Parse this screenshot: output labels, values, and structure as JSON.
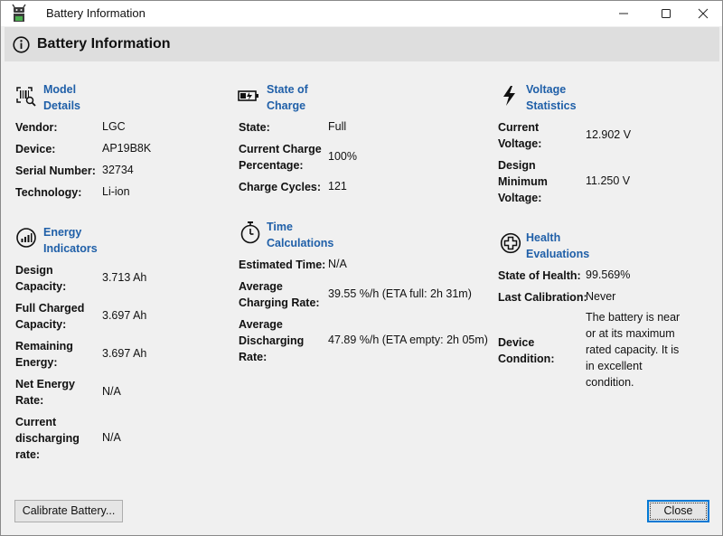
{
  "window": {
    "title": "Battery Information",
    "app_icon": "android-robot-icon"
  },
  "header": {
    "title": "Battery Information",
    "icon": "info-icon"
  },
  "model": {
    "title1": "Model",
    "title2": "Details",
    "icon": "barcode-scan-icon",
    "vendor_label": "Vendor:",
    "vendor_value": "LGC",
    "device_label": "Device:",
    "device_value": "AP19B8K",
    "serial_label": "Serial Number:",
    "serial_value": "32734",
    "tech_label": "Technology:",
    "tech_value": "Li-ion"
  },
  "energy": {
    "title1": "Energy",
    "title2": "Indicators",
    "icon": "gauge-icon",
    "design_label1": "Design",
    "design_label2": "Capacity:",
    "design_value": "3.713 Ah",
    "full_label1": "Full Charged",
    "full_label2": "Capacity:",
    "full_value": "3.697 Ah",
    "remaining_label1": "Remaining",
    "remaining_label2": "Energy:",
    "remaining_value": "3.697 Ah",
    "net_label1": "Net Energy",
    "net_label2": "Rate:",
    "net_value": "N/A",
    "current_label1": "Current",
    "current_label2": "discharging",
    "current_label3": "rate:",
    "current_value": "N/A"
  },
  "charge": {
    "title1": "State of",
    "title2": "Charge",
    "icon": "battery-charging-icon",
    "state_label": "State:",
    "state_value": "Full",
    "pct_label1": "Current Charge",
    "pct_label2": "Percentage:",
    "pct_value": "100%",
    "cycles_label": "Charge Cycles:",
    "cycles_value": "121"
  },
  "time": {
    "title1": "Time",
    "title2": "Calculations",
    "icon": "stopwatch-icon",
    "est_label": "Estimated Time:",
    "est_value": "N/A",
    "avg_charge_label1": "Average",
    "avg_charge_label2": "Charging Rate:",
    "avg_charge_value": "39.55 %/h (ETA full: 2h 31m)",
    "avg_dis_label1": "Average",
    "avg_dis_label2": "Discharging",
    "avg_dis_label3": "Rate:",
    "avg_dis_value": "47.89 %/h (ETA empty: 2h 05m)"
  },
  "voltage": {
    "title1": "Voltage",
    "title2": "Statistics",
    "icon": "lightning-icon",
    "current_label1": "Current",
    "current_label2": "Voltage:",
    "current_value": "12.902 V",
    "design_label1": "Design",
    "design_label2": "Minimum",
    "design_label3": "Voltage:",
    "design_value": "11.250 V"
  },
  "health": {
    "title1": "Health",
    "title2": "Evaluations",
    "icon": "medical-cross-icon",
    "state_label": "State of Health:",
    "state_value": "99.569%",
    "calib_label": "Last Calibration:",
    "calib_value": "Never",
    "cond_label1": "Device",
    "cond_label2": "Condition:",
    "cond_line1": "The battery is near",
    "cond_line2": "or at its maximum",
    "cond_line3": "rated capacity. It is",
    "cond_line4": "in excellent",
    "cond_line5": "condition."
  },
  "buttons": {
    "calibrate": "Calibrate Battery...",
    "close": "Close"
  }
}
